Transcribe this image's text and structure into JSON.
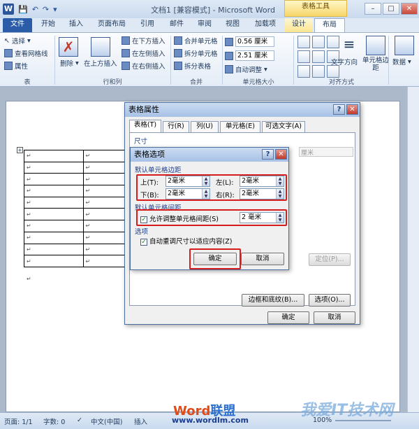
{
  "window": {
    "title": "文档1 [兼容模式] - Microsoft Word",
    "context_tab_group": "表格工具",
    "app_icon": "W",
    "controls": {
      "minimize": "–",
      "maximize": "□",
      "close": "✕"
    }
  },
  "tabs": {
    "file": "文件",
    "home": "开始",
    "insert": "插入",
    "layout": "页面布局",
    "references": "引用",
    "mailings": "邮件",
    "review": "审阅",
    "view": "视图",
    "addins": "加载项",
    "design": "设计",
    "table_layout": "布局"
  },
  "ribbon": {
    "table_group": {
      "label": "表",
      "select": "选择",
      "gridlines": "查看网格线",
      "properties": "属性"
    },
    "rowscols_group": {
      "label": "行和列",
      "delete": "删除",
      "insert_above": "在上方插入",
      "insert_below": "在下方插入",
      "insert_left": "在左侧插入",
      "insert_right": "在右侧插入"
    },
    "merge_group": {
      "label": "合并",
      "merge_cells": "合并单元格",
      "split_cells": "拆分单元格",
      "split_table": "拆分表格"
    },
    "cellsize_group": {
      "label": "单元格大小",
      "height": "0.56 厘米",
      "width": "2.51 厘米",
      "autofit": "自动调整"
    },
    "alignment_group": {
      "label": "对齐方式",
      "text_direction": "文字方向",
      "cell_margins": "单元格边距"
    },
    "data_group": {
      "label": "数据"
    }
  },
  "table_props_dialog": {
    "title": "表格属性",
    "tabs": {
      "table": "表格(T)",
      "row": "行(R)",
      "column": "列(U)",
      "cell": "单元格(E)",
      "alt_text": "可选文字(A)"
    },
    "size_section": "尺寸",
    "position_button": "定位(P)...",
    "borders_button": "边框和底纹(B)...",
    "options_button": "选项(O)...",
    "ok": "确定",
    "cancel": "取消",
    "bg_field_value": "厘米"
  },
  "table_options_dialog": {
    "title": "表格选项",
    "margins_section": "默认单元格边距",
    "top_label": "上(T):",
    "top_value": "2毫米",
    "left_label": "左(L):",
    "left_value": "2毫米",
    "bottom_label": "下(B):",
    "bottom_value": "2毫米",
    "right_label": "右(R):",
    "right_value": "2毫米",
    "spacing_section": "默认单元格间距",
    "allow_spacing_label": "允许调整单元格间距(S)",
    "spacing_value": "2 毫米",
    "options_section": "选项",
    "autoresize_label": "自动重调尺寸以适应内容(Z)",
    "ok": "确定",
    "cancel": "取消"
  },
  "document": {
    "cell_mark": "↵"
  },
  "statusbar": {
    "page": "页面: 1/1",
    "words": "字数: 0",
    "language": "中文(中国)",
    "mode": "插入",
    "zoom": "100%"
  },
  "watermark": {
    "brand_a": "Word",
    "brand_b": "联盟",
    "url": "www.wordlm.com",
    "site": "我爱IT技术网"
  },
  "colors": {
    "accent": "#2a5ca7",
    "highlight": "#d51d1d"
  }
}
